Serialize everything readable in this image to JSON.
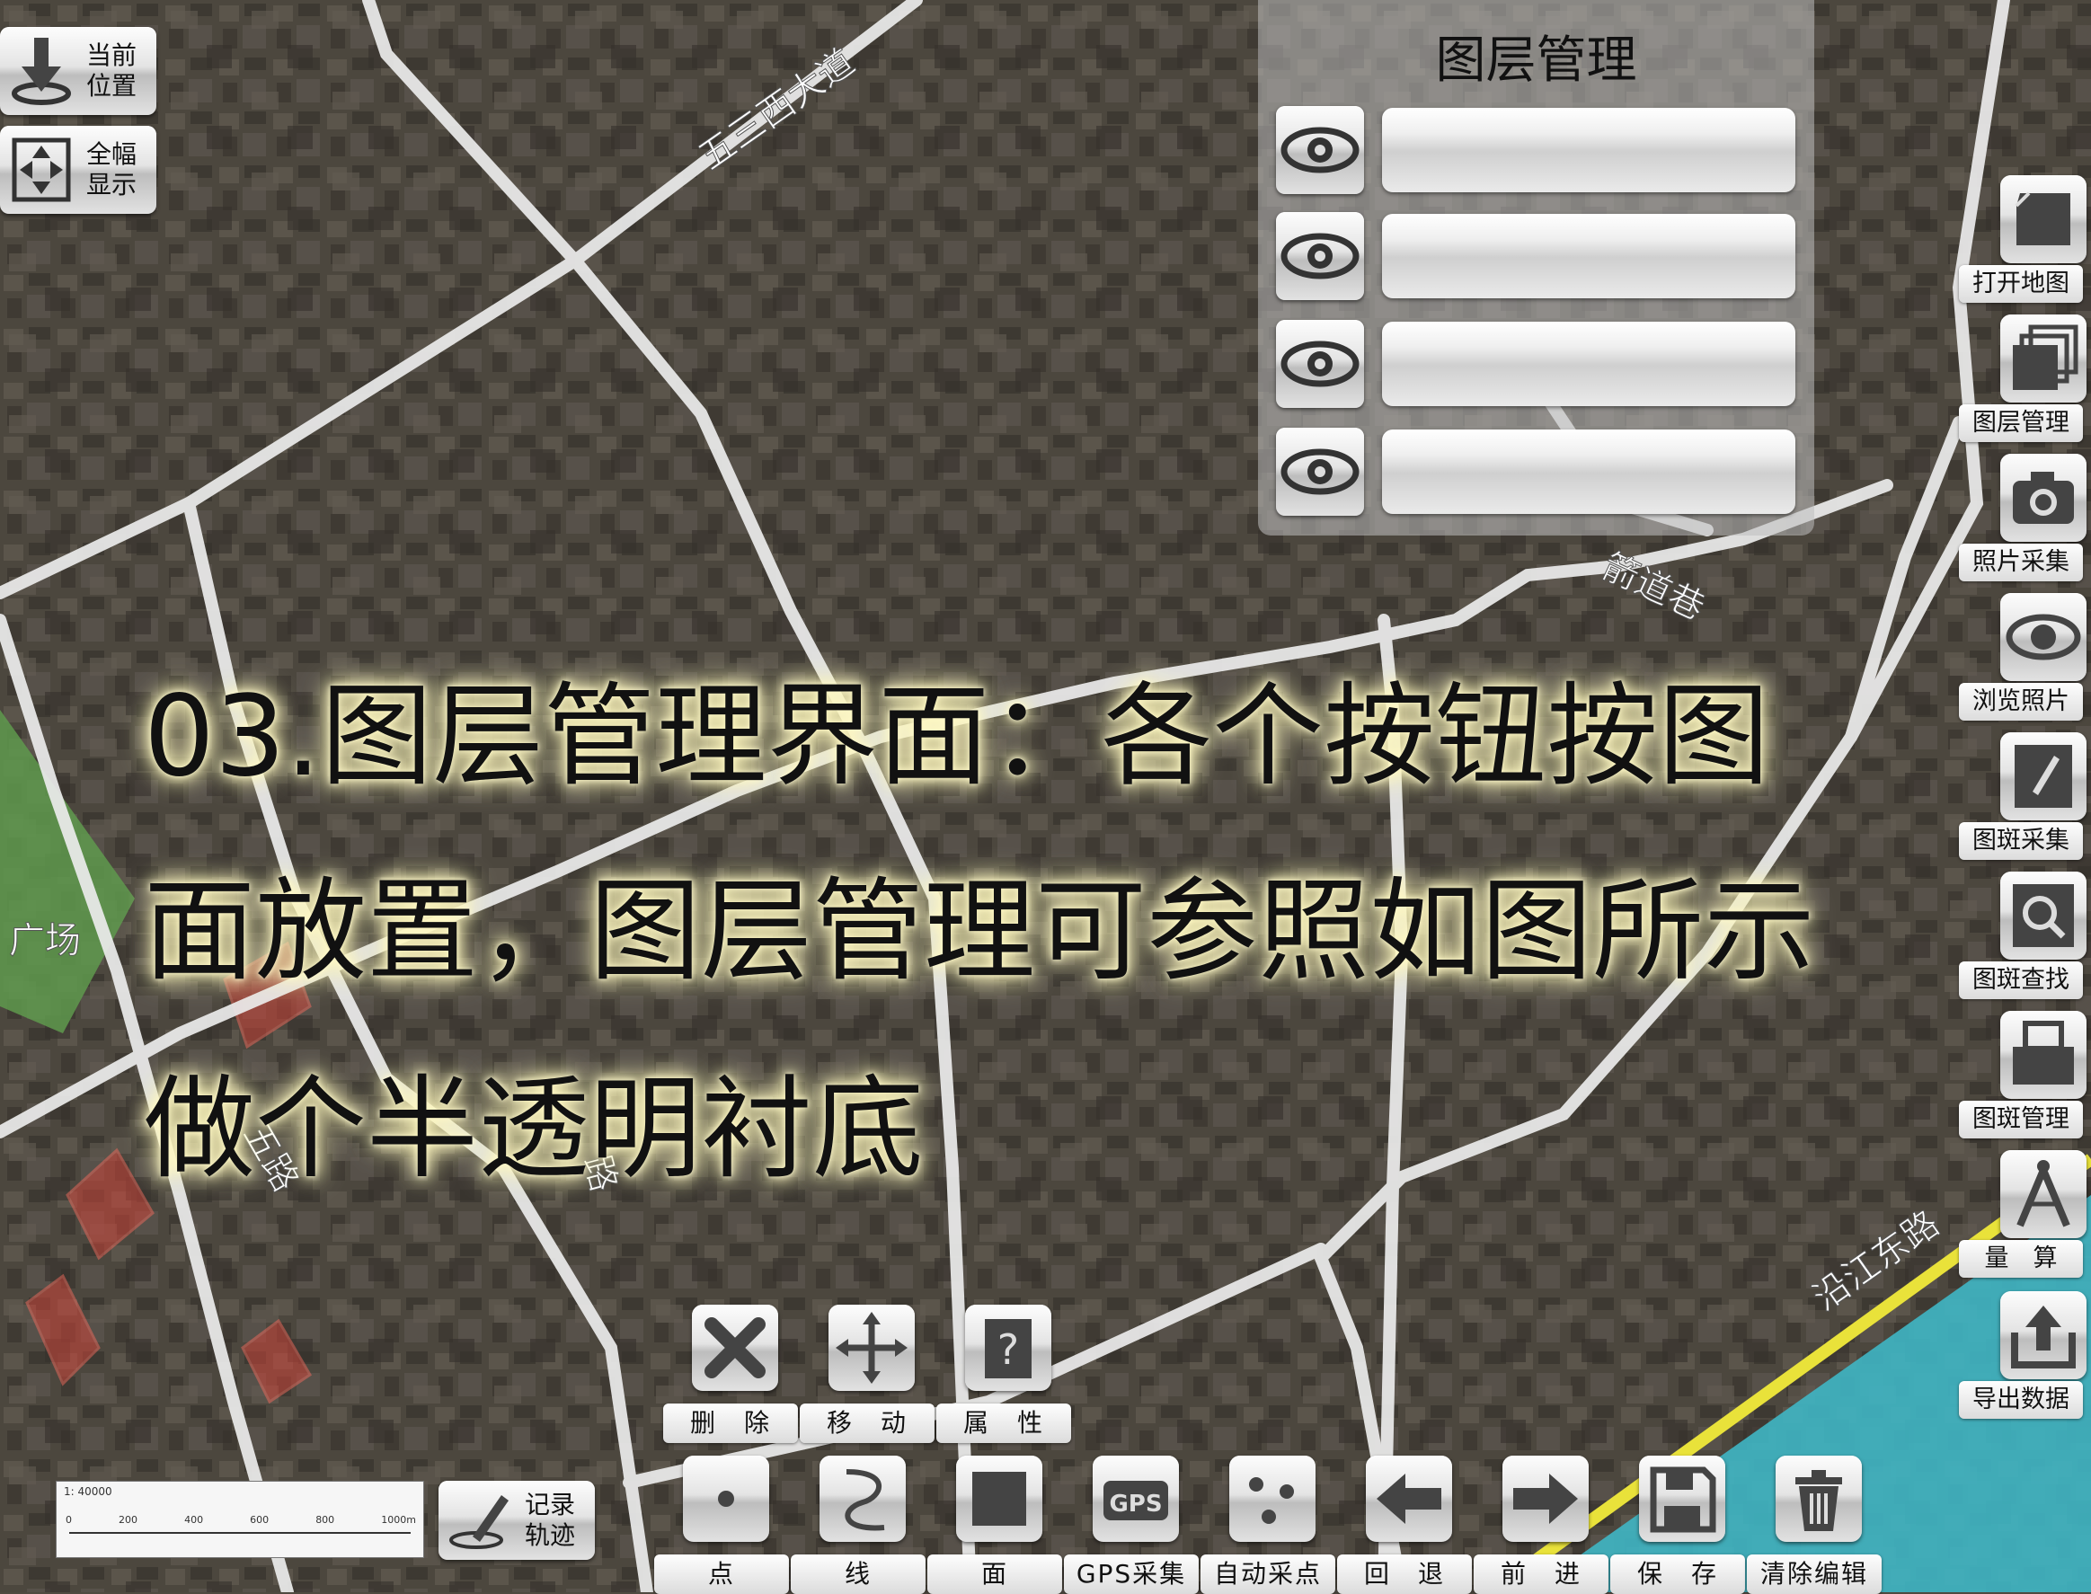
{
  "top_left": {
    "locate_label": "当前\n位置",
    "fullview_label": "全幅\n显示"
  },
  "layer_panel": {
    "title": "图层管理",
    "layers": [
      {
        "visible": true,
        "name": ""
      },
      {
        "visible": true,
        "name": ""
      },
      {
        "visible": true,
        "name": ""
      },
      {
        "visible": true,
        "name": ""
      }
    ]
  },
  "right_toolbar": [
    {
      "label": "打开地图",
      "icon": "open-map-icon"
    },
    {
      "label": "图层管理",
      "icon": "layers-icon"
    },
    {
      "label": "照片采集",
      "icon": "camera-icon"
    },
    {
      "label": "浏览照片",
      "icon": "eye-icon"
    },
    {
      "label": "图斑采集",
      "icon": "pen-icon"
    },
    {
      "label": "图斑查找",
      "icon": "magnifier-icon"
    },
    {
      "label": "图斑管理",
      "icon": "manage-icon"
    },
    {
      "label": "量　算",
      "icon": "compass-icon"
    },
    {
      "label": "导出数据",
      "icon": "export-icon"
    }
  ],
  "overlay_message": {
    "line1": "03.图层管理界面：各个按钮按图",
    "line2": "面放置，图层管理可参照如图所示",
    "line3": "做个半透明衬底"
  },
  "edit_toolbar": [
    {
      "label": "删　除",
      "icon": "delete-icon"
    },
    {
      "label": "移　动",
      "icon": "move-icon"
    },
    {
      "label": "属　性",
      "icon": "properties-icon"
    }
  ],
  "bottom_toolbar": [
    {
      "label": "点",
      "icon": "point-icon"
    },
    {
      "label": "线",
      "icon": "line-icon"
    },
    {
      "label": "面",
      "icon": "polygon-icon"
    },
    {
      "label": "GPS采集",
      "icon": "gps-icon"
    },
    {
      "label": "自动采点",
      "icon": "auto-point-icon"
    },
    {
      "label": "回　退",
      "icon": "back-arrow-icon"
    },
    {
      "label": "前　进",
      "icon": "forward-arrow-icon"
    },
    {
      "label": "保　存",
      "icon": "save-icon"
    },
    {
      "label": "清除编辑",
      "icon": "trash-icon"
    }
  ],
  "track_button": {
    "label": "记录\n轨迹"
  },
  "scale": {
    "ratio": "1: 40000",
    "ticks": [
      "0",
      "200",
      "400",
      "600",
      "800",
      "1000m"
    ]
  },
  "map_labels": [
    {
      "text": "五三西大道"
    },
    {
      "text": "箭道巷"
    },
    {
      "text": "广场"
    },
    {
      "text": "沿江东路"
    },
    {
      "text": "五路"
    },
    {
      "text": "路"
    }
  ],
  "colors": {
    "panel_bg": "rgba(190,190,190,0.55)",
    "text_glow": "#fff9c8",
    "river": "#3fb6c4",
    "embankment": "#e9e23a",
    "park": "#5f9a4e",
    "highlight_parcel": "#d9453a"
  }
}
